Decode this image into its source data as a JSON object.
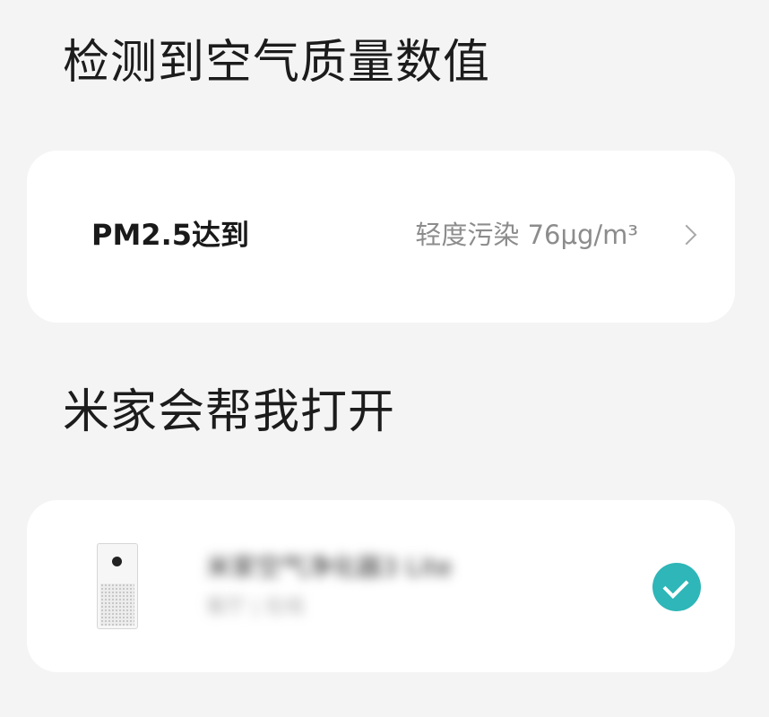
{
  "titles": {
    "detect": "检测到空气质量数值",
    "action": "米家会帮我打开"
  },
  "condition": {
    "label": "PM2.5达到",
    "value": "轻度污染 76μg/m³"
  },
  "device": {
    "name": "米家空气净化器3 Lite",
    "subtitle": "客厅 | 在线",
    "selected": true,
    "image_icon": "air-purifier-icon",
    "check_icon": "check-circle-icon"
  },
  "colors": {
    "background": "#f4f4f4",
    "card": "#ffffff",
    "accent": "#2eb6b8"
  }
}
